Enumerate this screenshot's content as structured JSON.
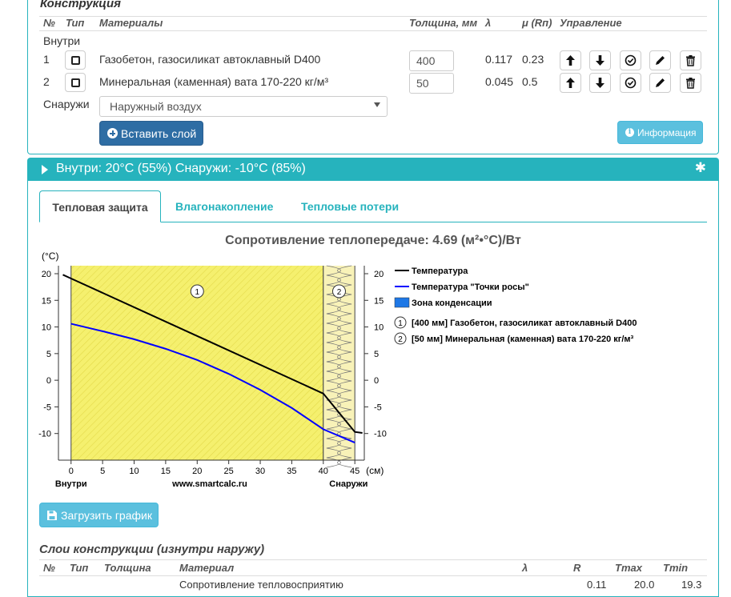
{
  "construction": {
    "title": "Конструкция",
    "headers": {
      "num": "№",
      "type": "Тип",
      "materials": "Материалы",
      "thickness": "Толщина, мм",
      "lambda": "λ",
      "mu": "μ (Rп)",
      "controls": "Управление"
    },
    "inside_label": "Внутри",
    "outside_label": "Снаружи",
    "rows": [
      {
        "num": "1",
        "material": "Газобетон, газосиликат автоклавный D400",
        "thickness": "400",
        "lambda": "0.117",
        "mu": "0.23"
      },
      {
        "num": "2",
        "material": "Минеральная (каменная) вата 170-220 кг/м³",
        "thickness": "50",
        "lambda": "0.045",
        "mu": "0.5"
      }
    ],
    "outside_select": "Наружный воздух",
    "insert_layer_button": "Вставить слой",
    "info_button": "Информация"
  },
  "conditions": {
    "text": "Внутри: 20°C (55%) Снаружи: -10°C (85%)"
  },
  "tabs": [
    {
      "label": "Тепловая защита",
      "active": true
    },
    {
      "label": "Влагонакопление",
      "active": false
    },
    {
      "label": "Тепловые потери",
      "active": false
    }
  ],
  "chart_data": {
    "type": "line",
    "title": "Сопротивление теплопередаче: 4.69 (м²•°C)/Вт",
    "ylabel": "(°C)",
    "xlabel": "(см)",
    "x_left_label": "Внутри",
    "x_center_label": "www.smartcalc.ru",
    "x_right_label": "Снаружи",
    "xlim": [
      -2,
      46.5
    ],
    "ylim": [
      -15,
      21.5
    ],
    "xticks": [
      0,
      5,
      10,
      15,
      20,
      25,
      30,
      35,
      40,
      45
    ],
    "yticks": [
      20,
      15,
      10,
      5,
      0,
      -5,
      -10
    ],
    "layers": [
      {
        "marker": "1",
        "from": 0,
        "to": 40,
        "fill": "#f5f06e"
      },
      {
        "marker": "2",
        "from": 40,
        "to": 45,
        "fill": "#f8f2b8"
      }
    ],
    "series": [
      {
        "name": "Температура",
        "color": "#000000",
        "points": [
          [
            -1.3,
            19.8
          ],
          [
            0,
            19.1
          ],
          [
            40,
            -2.5
          ],
          [
            45,
            -9.7
          ],
          [
            46.2,
            -9.9
          ]
        ]
      },
      {
        "name": "Температура \"Точки росы\"",
        "color": "#0000ff",
        "points": [
          [
            0,
            10.6
          ],
          [
            5,
            9.2
          ],
          [
            10,
            7.7
          ],
          [
            15,
            5.9
          ],
          [
            20,
            3.8
          ],
          [
            25,
            1.2
          ],
          [
            30,
            -1.8
          ],
          [
            35,
            -5.2
          ],
          [
            40,
            -9.2
          ],
          [
            45,
            -11.7
          ]
        ]
      }
    ],
    "legend": [
      {
        "type": "line",
        "color": "#000000",
        "label": "Температура"
      },
      {
        "type": "line",
        "color": "#0000ff",
        "label": "Температура \"Точки росы\""
      },
      {
        "type": "box",
        "color": "#1e78e6",
        "label": "Зона конденсации"
      },
      {
        "type": "circle",
        "marker": "1",
        "label": "[400 мм] Газобетон, газосиликат автоклавный D400"
      },
      {
        "type": "circle",
        "marker": "2",
        "label": "[50 мм] Минеральная (каменная) вата 170-220 кг/м³"
      }
    ],
    "legend_position": "right"
  },
  "download_button": "Загрузить график",
  "layers_table": {
    "title": "Слои конструкции (изнутри наружу)",
    "headers": {
      "num": "№",
      "type": "Тип",
      "thickness": "Толщина",
      "material": "Материал",
      "lambda": "λ",
      "r": "R",
      "tmax": "Tmax",
      "tmin": "Tmin"
    },
    "first_row": {
      "material": "Сопротивление тепловосприятию",
      "r": "0.11",
      "tmax": "20.0",
      "tmin": "19.3"
    }
  }
}
